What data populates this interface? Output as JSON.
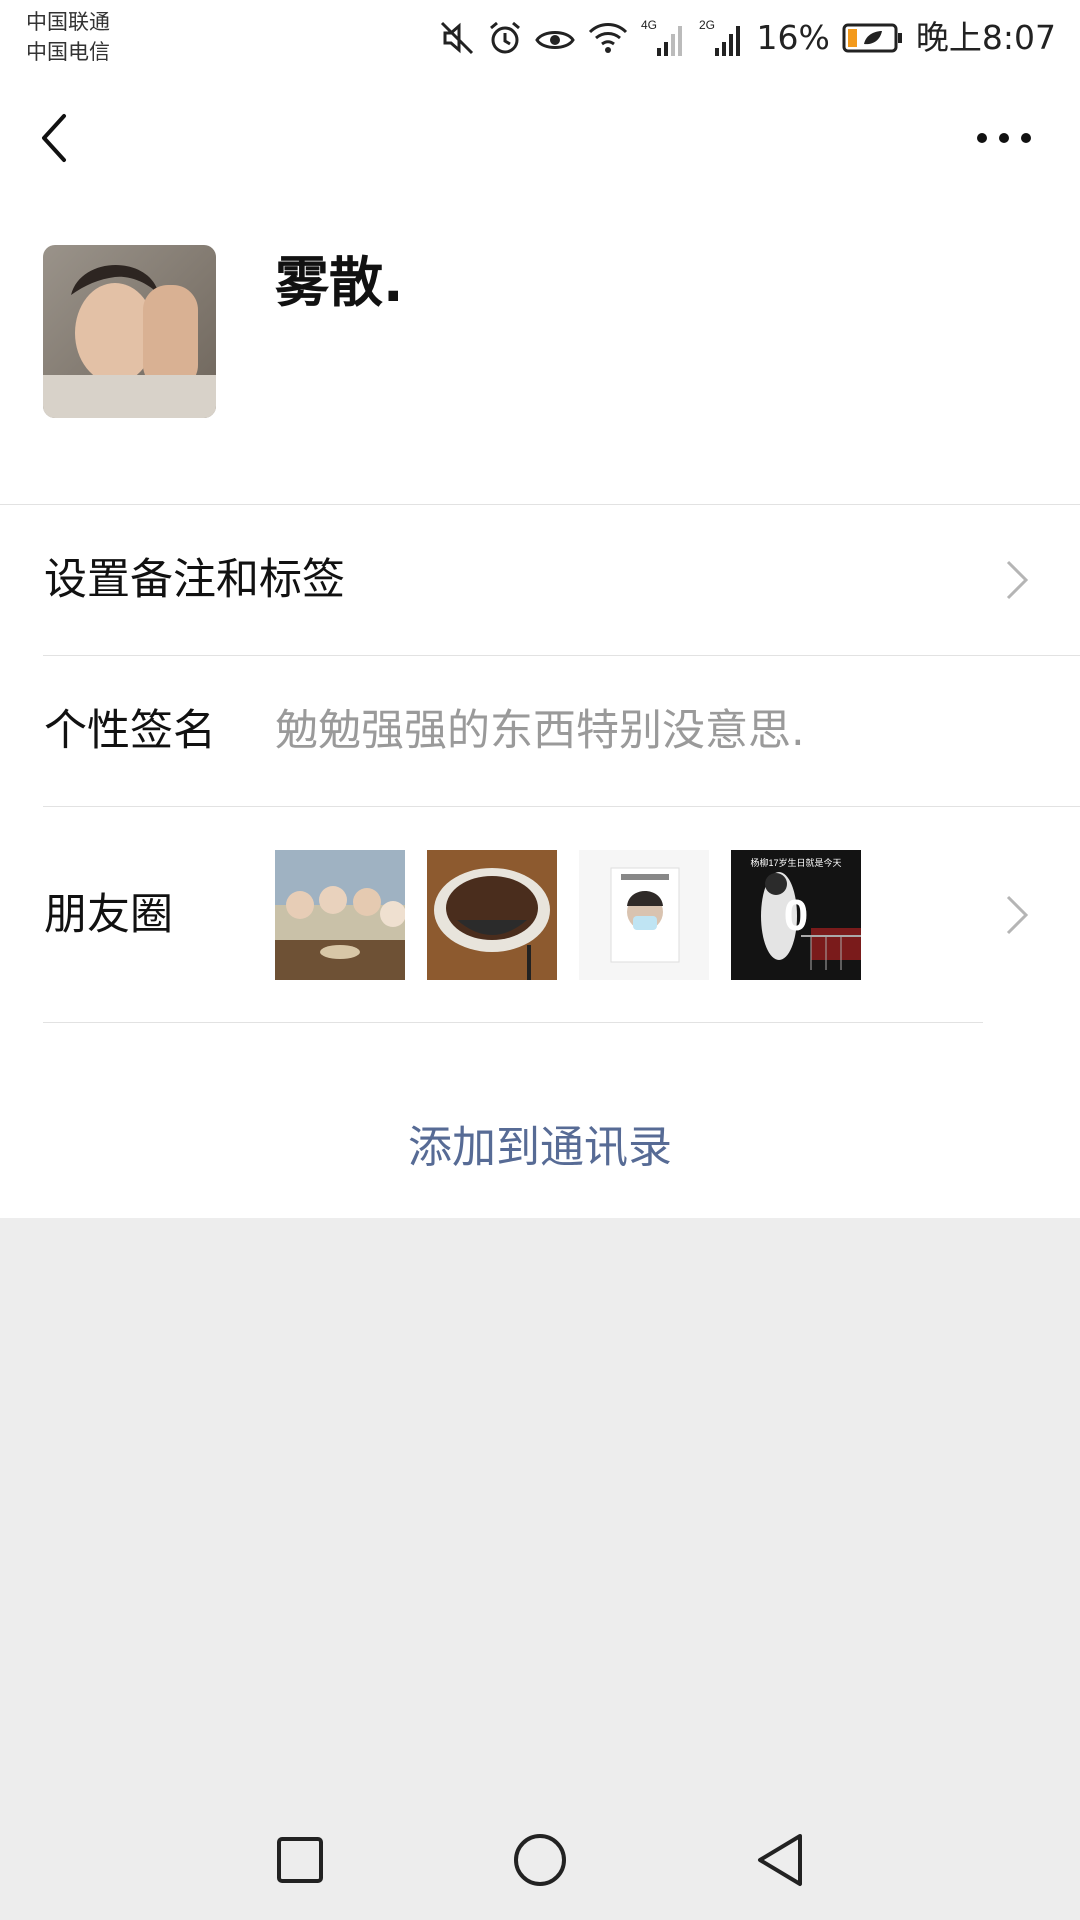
{
  "status_bar": {
    "carrier_1": "中国联通",
    "carrier_2": "中国电信",
    "net_4g": "4G",
    "net_2g": "2G",
    "battery": "16%",
    "time": "晚上8:07",
    "icons": [
      "mute-icon",
      "alarm-icon",
      "eye-icon",
      "wifi-icon",
      "signal-4g-icon",
      "signal-2g-icon",
      "battery-icon"
    ]
  },
  "nav": {
    "back_icon": "chevron-left-icon",
    "more_icon": "more-dots-icon"
  },
  "profile": {
    "name": "雾散."
  },
  "rows": {
    "remark_label": "设置备注和标签",
    "signature_label": "个性签名",
    "signature_value": "勉勉强强的东西特别没意思.",
    "moments_label": "朋友圈",
    "moments_thumb_4_caption": "杨柳17岁生日就是今天",
    "moments_thumb_4_big": "0"
  },
  "actions": {
    "add_contact": "添加到通讯录"
  },
  "colors": {
    "link": "#576b95",
    "background": "#ededed"
  }
}
